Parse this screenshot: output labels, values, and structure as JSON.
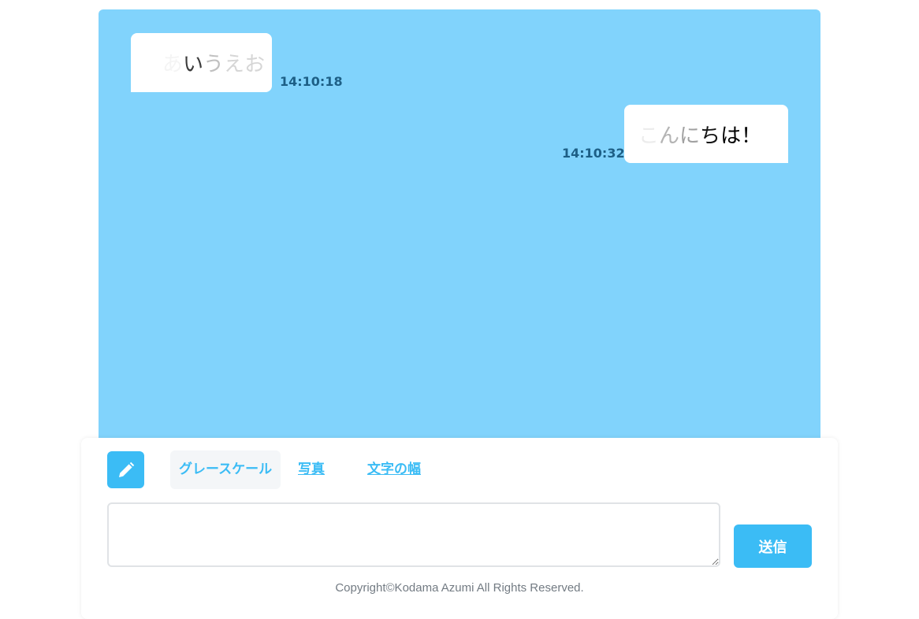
{
  "messages": [
    {
      "side": "left",
      "chars": [
        {
          "text": "あ",
          "color": "#f4f4f4"
        },
        {
          "text": "い",
          "color": "#3c3c3c"
        },
        {
          "text": "う",
          "color": "#c0c0c0"
        },
        {
          "text": "え",
          "color": "#d6d6d6"
        },
        {
          "text": "お",
          "color": "#d6d6d6"
        }
      ],
      "time": "14:10:18"
    },
    {
      "side": "right",
      "chars": [
        {
          "text": "こ",
          "color": "#ececec"
        },
        {
          "text": "ん",
          "color": "#b4b4b4"
        },
        {
          "text": "に",
          "color": "#a0a0a0"
        },
        {
          "text": "ち",
          "color": "#141414"
        },
        {
          "text": "は",
          "color": "#000000"
        },
        {
          "text": "！",
          "color": "#000000"
        }
      ],
      "time": "14:10:32"
    }
  ],
  "toolbar": {
    "pencil_icon": "pencil-icon",
    "tabs": [
      {
        "label": "グレースケール",
        "active": true
      },
      {
        "label": "写真",
        "active": false
      },
      {
        "label": "文字の幅",
        "active": false
      }
    ]
  },
  "input": {
    "value": "",
    "placeholder": ""
  },
  "send_label": "送信",
  "footer": "Copyright©Kodama Azumi All Rights Reserved.",
  "colors": {
    "chat_bg": "#81d3fc",
    "accent": "#3bbcf5",
    "timestamp": "#1d5f86"
  }
}
